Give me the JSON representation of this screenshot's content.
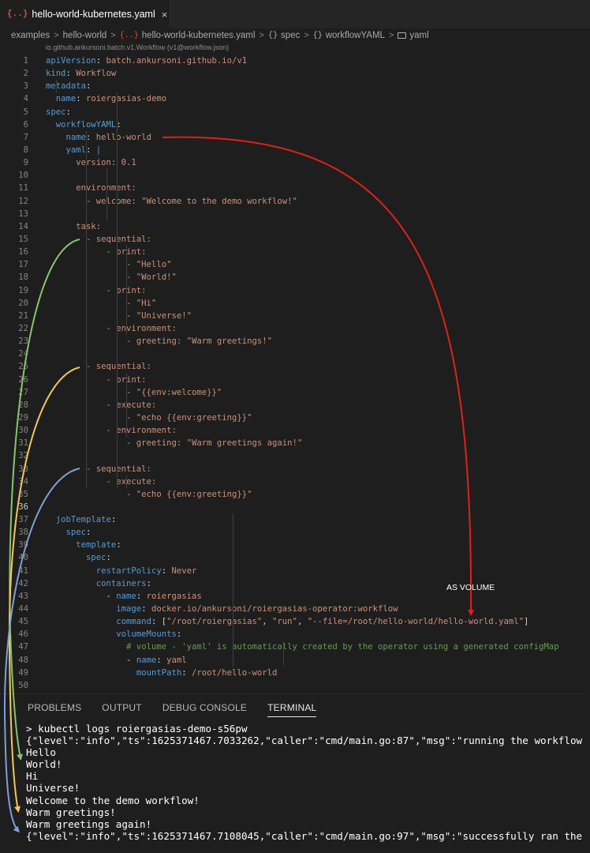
{
  "tab": {
    "icon": "{..}",
    "title": "hello-world-kubernetes.yaml",
    "close": "×"
  },
  "breadcrumb": {
    "items": [
      "examples",
      "hello-world",
      "hello-world-kubernetes.yaml",
      "spec",
      "workflowYAML",
      "yaml"
    ],
    "separator": ">",
    "icon_yaml": "{..}",
    "icon_obj": "{}"
  },
  "schema_hint": "io.github.ankursoni.batch.v1.Workflow (v1@workflow.json)",
  "code_lines": [
    [
      [
        "k",
        "apiVersion"
      ],
      [
        "p",
        ": "
      ],
      [
        "s",
        "batch.ankursoni.github.io/v1"
      ]
    ],
    [
      [
        "k",
        "kind"
      ],
      [
        "p",
        ": "
      ],
      [
        "s",
        "Workflow"
      ]
    ],
    [
      [
        "k",
        "metadata"
      ],
      [
        "p",
        ":"
      ]
    ],
    [
      [
        "p",
        "  "
      ],
      [
        "k",
        "name"
      ],
      [
        "p",
        ": "
      ],
      [
        "s",
        "roiergasias-demo"
      ]
    ],
    [
      [
        "k",
        "spec"
      ],
      [
        "p",
        ":"
      ]
    ],
    [
      [
        "p",
        "  "
      ],
      [
        "k",
        "workflowYAML"
      ],
      [
        "p",
        ":"
      ]
    ],
    [
      [
        "p",
        "    "
      ],
      [
        "k",
        "name"
      ],
      [
        "p",
        ": "
      ],
      [
        "s",
        "hello-world"
      ]
    ],
    [
      [
        "p",
        "    "
      ],
      [
        "k",
        "yaml"
      ],
      [
        "p",
        ": "
      ],
      [
        "k",
        "|"
      ]
    ],
    [
      [
        "s",
        "      version: 0.1"
      ]
    ],
    [
      [
        "s",
        ""
      ]
    ],
    [
      [
        "s",
        "      environment:"
      ]
    ],
    [
      [
        "s",
        "        - welcome: \"Welcome to the demo workflow!\""
      ]
    ],
    [
      [
        "s",
        ""
      ]
    ],
    [
      [
        "s",
        "      task:"
      ]
    ],
    [
      [
        "s",
        "        - sequential:"
      ]
    ],
    [
      [
        "s",
        "            - print:"
      ]
    ],
    [
      [
        "s",
        "                - \"Hello\""
      ]
    ],
    [
      [
        "s",
        "                - \"World!\""
      ]
    ],
    [
      [
        "s",
        "            - print:"
      ]
    ],
    [
      [
        "s",
        "                - \"Hi\""
      ]
    ],
    [
      [
        "s",
        "                - \"Universe!\""
      ]
    ],
    [
      [
        "s",
        "            - environment:"
      ]
    ],
    [
      [
        "s",
        "                - greeting: \"Warm greetings!\""
      ]
    ],
    [
      [
        "s",
        ""
      ]
    ],
    [
      [
        "s",
        "        - sequential:"
      ]
    ],
    [
      [
        "s",
        "            - print:"
      ]
    ],
    [
      [
        "s",
        "                - \"{{env:welcome}}\""
      ]
    ],
    [
      [
        "s",
        "            - execute:"
      ]
    ],
    [
      [
        "s",
        "                - \"echo {{env:greeting}}\""
      ]
    ],
    [
      [
        "s",
        "            - environment:"
      ]
    ],
    [
      [
        "s",
        "                - greeting: \"Warm greetings again!\""
      ]
    ],
    [
      [
        "s",
        ""
      ]
    ],
    [
      [
        "s",
        "        - sequential:"
      ]
    ],
    [
      [
        "s",
        "            - execute:"
      ]
    ],
    [
      [
        "s",
        "                - \"echo {{env:greeting}}\""
      ]
    ],
    [
      [
        "s",
        ""
      ]
    ],
    [
      [
        "p",
        "  "
      ],
      [
        "k",
        "jobTemplate"
      ],
      [
        "p",
        ":"
      ]
    ],
    [
      [
        "p",
        "    "
      ],
      [
        "k",
        "spec"
      ],
      [
        "p",
        ":"
      ]
    ],
    [
      [
        "p",
        "      "
      ],
      [
        "k",
        "template"
      ],
      [
        "p",
        ":"
      ]
    ],
    [
      [
        "p",
        "        "
      ],
      [
        "k",
        "spec"
      ],
      [
        "p",
        ":"
      ]
    ],
    [
      [
        "p",
        "          "
      ],
      [
        "k",
        "restartPolicy"
      ],
      [
        "p",
        ": "
      ],
      [
        "s",
        "Never"
      ]
    ],
    [
      [
        "p",
        "          "
      ],
      [
        "k",
        "containers"
      ],
      [
        "p",
        ":"
      ]
    ],
    [
      [
        "p",
        "            - "
      ],
      [
        "k",
        "name"
      ],
      [
        "p",
        ": "
      ],
      [
        "s",
        "roiergasias"
      ]
    ],
    [
      [
        "p",
        "              "
      ],
      [
        "k",
        "image"
      ],
      [
        "p",
        ": "
      ],
      [
        "s",
        "docker.io/ankursoni/roiergasias-operator:workflow"
      ]
    ],
    [
      [
        "p",
        "              "
      ],
      [
        "k",
        "command"
      ],
      [
        "p",
        ": ["
      ],
      [
        "s",
        "\"/root/roiergasias\""
      ],
      [
        "p",
        ", "
      ],
      [
        "s",
        "\"run\""
      ],
      [
        "p",
        ", "
      ],
      [
        "s",
        "\"--file=/root/hello-world/hello-world.yaml\""
      ],
      [
        "p",
        "]"
      ]
    ],
    [
      [
        "p",
        "              "
      ],
      [
        "k",
        "volumeMounts"
      ],
      [
        "p",
        ":"
      ]
    ],
    [
      [
        "p",
        "                "
      ],
      [
        "c",
        "# volume - 'yaml' is automatically created by the operator using a generated configMap"
      ]
    ],
    [
      [
        "p",
        "                - "
      ],
      [
        "k",
        "name"
      ],
      [
        "p",
        ": "
      ],
      [
        "s",
        "yaml"
      ]
    ],
    [
      [
        "p",
        "                  "
      ],
      [
        "k",
        "mountPath"
      ],
      [
        "p",
        ": "
      ],
      [
        "s",
        "/root/hello-world"
      ]
    ],
    [
      [
        "s",
        ""
      ]
    ]
  ],
  "current_line": 36,
  "panel": {
    "tabs": [
      "PROBLEMS",
      "OUTPUT",
      "DEBUG CONSOLE",
      "TERMINAL"
    ],
    "active_tab": "TERMINAL"
  },
  "terminal_lines": [
    "> kubectl logs roiergasias-demo-s56pw",
    "{\"level\":\"info\",\"ts\":1625371467.7033262,\"caller\":\"cmd/main.go:87\",\"msg\":\"running the workflow",
    "Hello",
    "World!",
    "Hi",
    "Universe!",
    "Welcome to the demo workflow!",
    "Warm greetings!",
    "Warm greetings again!",
    "{\"level\":\"info\",\"ts\":1625371467.7108045,\"caller\":\"cmd/main.go:97\",\"msg\":\"successfully ran the"
  ],
  "annotation": "AS VOLUME",
  "colors": {
    "key": "#569cd6",
    "string": "#ce9178",
    "comment": "#6a9955",
    "arrow_red": "#e0201a",
    "arrow_green": "#86c66b",
    "arrow_yellow": "#f2c75c",
    "arrow_blue": "#7f9fd6"
  }
}
